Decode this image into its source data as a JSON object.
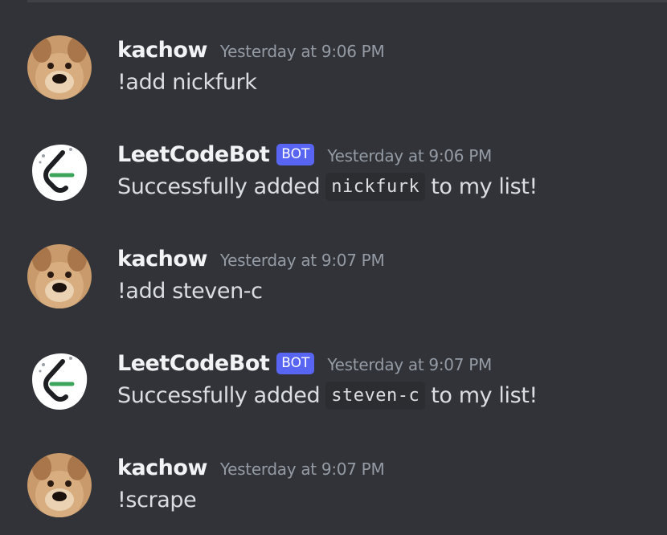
{
  "messages": [
    {
      "author": "kachow",
      "avatar": "dog-avatar",
      "is_bot": false,
      "timestamp": "Yesterday at 9:06 PM",
      "text": "!add nickfurk"
    },
    {
      "author": "LeetCodeBot",
      "avatar": "leetcode-bot-avatar",
      "is_bot": true,
      "bot_tag": "BOT",
      "timestamp": "Yesterday at 9:06 PM",
      "text_before": "Successfully added",
      "code": "nickfurk",
      "text_after": "to my list!"
    },
    {
      "author": "kachow",
      "avatar": "dog-avatar",
      "is_bot": false,
      "timestamp": "Yesterday at 9:07 PM",
      "text": "!add steven-c"
    },
    {
      "author": "LeetCodeBot",
      "avatar": "leetcode-bot-avatar",
      "is_bot": true,
      "bot_tag": "BOT",
      "timestamp": "Yesterday at 9:07 PM",
      "text_before": "Successfully added",
      "code": "steven-c",
      "text_after": "to my list!"
    },
    {
      "author": "kachow",
      "avatar": "dog-avatar",
      "is_bot": false,
      "timestamp": "Yesterday at 9:07 PM",
      "text": "!scrape"
    }
  ],
  "colors": {
    "background": "#313338",
    "username": "#f2f3f5",
    "timestamp": "#949ba4",
    "message_text": "#dbdee1",
    "bot_tag": "#5865f2",
    "code_background": "#2b2d31"
  }
}
